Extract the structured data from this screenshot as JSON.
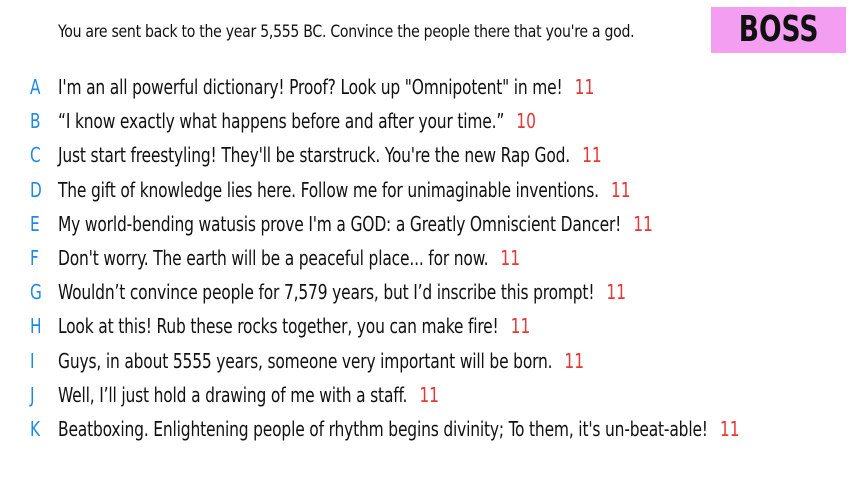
{
  "prompt": "You are sent back to the year 5,555 BC. Convince the people there that you're a god.",
  "badge": "BOSS",
  "colors": {
    "letter": "#1e88e5",
    "score": "#e53935",
    "badge_bg": "#f39ef0"
  },
  "answers": [
    {
      "letter": "A",
      "text": "I'm an all powerful dictionary! Proof? Look up \"Omnipotent\" in me!",
      "score": "11"
    },
    {
      "letter": "B",
      "text": "“I know exactly what happens before and after your time.”",
      "score": "10"
    },
    {
      "letter": "C",
      "text": "Just start freestyling! They'll be starstruck. You're the new Rap God.",
      "score": "11"
    },
    {
      "letter": "D",
      "text": "The gift of knowledge lies here. Follow me for unimaginable inventions.",
      "score": "11"
    },
    {
      "letter": "E",
      "text": "My world-bending watusis prove I'm a GOD: a Greatly Omniscient Dancer!",
      "score": "11"
    },
    {
      "letter": "F",
      "text": "Don't worry. The earth will be a peaceful place... for now.",
      "score": "11"
    },
    {
      "letter": "G",
      "text": "Wouldn’t convince people for 7,579 years, but I’d inscribe this prompt!",
      "score": "11"
    },
    {
      "letter": "H",
      "text": "Look at this! Rub these rocks together, you can make fire!",
      "score": "11"
    },
    {
      "letter": "I",
      "text": "Guys, in about 5555 years, someone very important will be born.",
      "score": "11"
    },
    {
      "letter": "J",
      "text": "Well, I’ll just hold a drawing of me with a staff.",
      "score": "11"
    },
    {
      "letter": "K",
      "text": "Beatboxing. Enlightening people of rhythm begins divinity; To them, it's un-beat-able!",
      "score": "11"
    }
  ]
}
